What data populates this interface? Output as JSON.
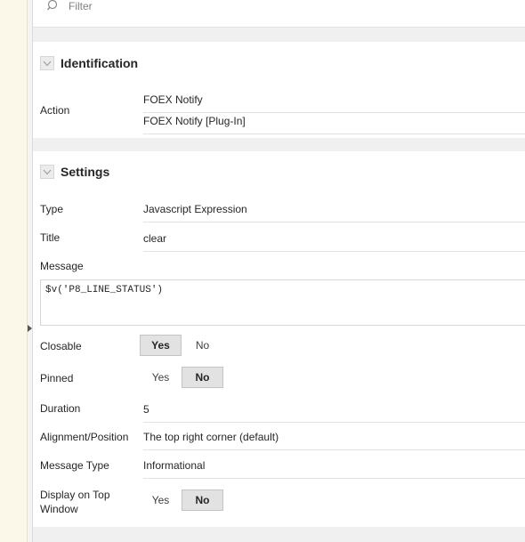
{
  "filter": {
    "placeholder": "Filter"
  },
  "identification": {
    "title": "Identification",
    "action_label": "Action",
    "action_value": "FOEX Notify",
    "action_type": "FOEX Notify [Plug-In]"
  },
  "settings": {
    "title": "Settings",
    "type_label": "Type",
    "type_value": "Javascript Expression",
    "title_label": "Title",
    "title_value": "clear",
    "message_label": "Message",
    "message_value": "$v('P8_LINE_STATUS')",
    "closable_label": "Closable",
    "closable": {
      "yes": "Yes",
      "no": "No",
      "selected": "Yes"
    },
    "pinned_label": "Pinned",
    "pinned": {
      "yes": "Yes",
      "no": "No",
      "selected": "No"
    },
    "duration_label": "Duration",
    "duration_value": "5",
    "alignment_label": "Alignment/Position",
    "alignment_value": "The top right corner (default)",
    "message_type_label": "Message Type",
    "message_type_value": "Informational",
    "display_top_label": "Display on Top Window",
    "display_top": {
      "yes": "Yes",
      "no": "No",
      "selected": "No"
    }
  }
}
